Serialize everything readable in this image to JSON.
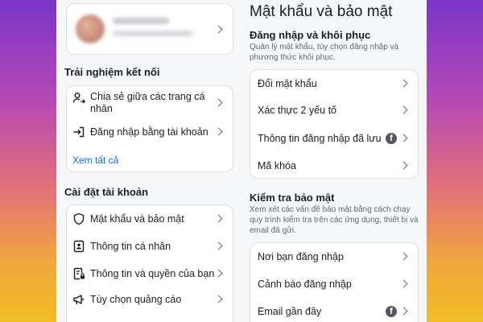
{
  "left": {
    "profile": {
      "name_blurred": "",
      "subtitle_blurred": ""
    },
    "connected_experiences": {
      "title": "Trải nghiệm kết nối",
      "items": [
        {
          "label_line1": "Chia sẻ giữa các trang cá",
          "label_line2": "nhân",
          "icon": "share-person-icon"
        },
        {
          "label": "Đăng nhập bằng tài khoản",
          "icon": "login-arrow-icon"
        }
      ],
      "see_all": "Xem tất cả"
    },
    "account_settings": {
      "title": "Cài đặt tài khoản",
      "items": [
        {
          "label": "Mật khẩu và bảo mật",
          "icon": "shield-icon"
        },
        {
          "label": "Thông tin cá nhân",
          "icon": "id-card-icon"
        },
        {
          "label": "Thông tin và quyền của bạn",
          "icon": "document-lock-icon"
        },
        {
          "label": "Tùy chọn quảng cáo",
          "icon": "megaphone-icon"
        }
      ]
    }
  },
  "right": {
    "title": "Mật khẩu và bảo mật",
    "login_recovery": {
      "title": "Đăng nhập và khôi phục",
      "description": "Quản lý mật khẩu, tùy chọn đăng nhập và phương thức khôi phục.",
      "items": [
        {
          "label": "Đổi mật khẩu"
        },
        {
          "label": "Xác thực 2 yếu tố"
        },
        {
          "label": "Thông tin đăng nhập đã lưu",
          "badge": "f"
        },
        {
          "label": "Mã khóa"
        }
      ]
    },
    "security_checks": {
      "title": "Kiểm tra bảo mật",
      "description": "Xem xét các vấn đề bảo mật bằng cách chạy quy trình kiểm tra trên các ứng dụng, thiết bị và email đã gửi.",
      "items": [
        {
          "label": "Nơi bạn đăng nhập"
        },
        {
          "label": "Cảnh báo đăng nhập"
        },
        {
          "label": "Email gần đây",
          "badge": "f"
        }
      ]
    }
  },
  "colors": {
    "link": "#0866ff",
    "text": "#1c1e21",
    "secondary": "#65676b",
    "panel": "#f6f7f9"
  }
}
